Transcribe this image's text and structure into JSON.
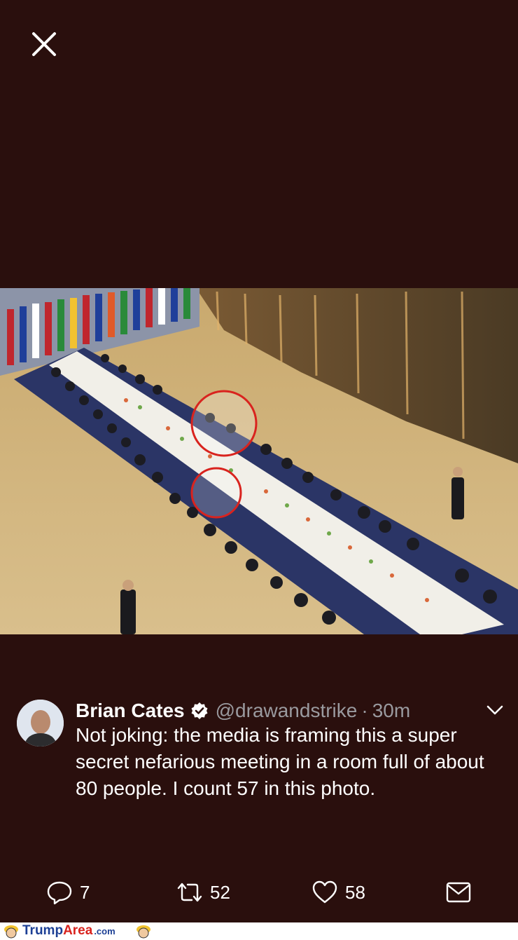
{
  "close_icon": "close-icon",
  "photo": {
    "description_icon": "photo",
    "highlight_color": "#d9231e"
  },
  "tweet": {
    "display_name": "Brian Cates",
    "verified_icon": "verified-icon",
    "handle": "@drawandstrike",
    "separator": "·",
    "timestamp": "30m",
    "text": "Not joking: the media is framing this a super secret nefarious meeting in a room full of about 80 people. I count 57 in this photo."
  },
  "actions": {
    "reply_count": "7",
    "retweet_count": "52",
    "like_count": "58"
  },
  "footer": {
    "brand_trump": "Trump",
    "brand_area": "Area",
    "brand_com": ".com"
  },
  "colors": {
    "background": "#2a0f0d",
    "text_primary": "#ffffff",
    "text_secondary": "#9a9a9f",
    "brand_blue": "#1c3f95",
    "brand_red": "#d9231e"
  }
}
